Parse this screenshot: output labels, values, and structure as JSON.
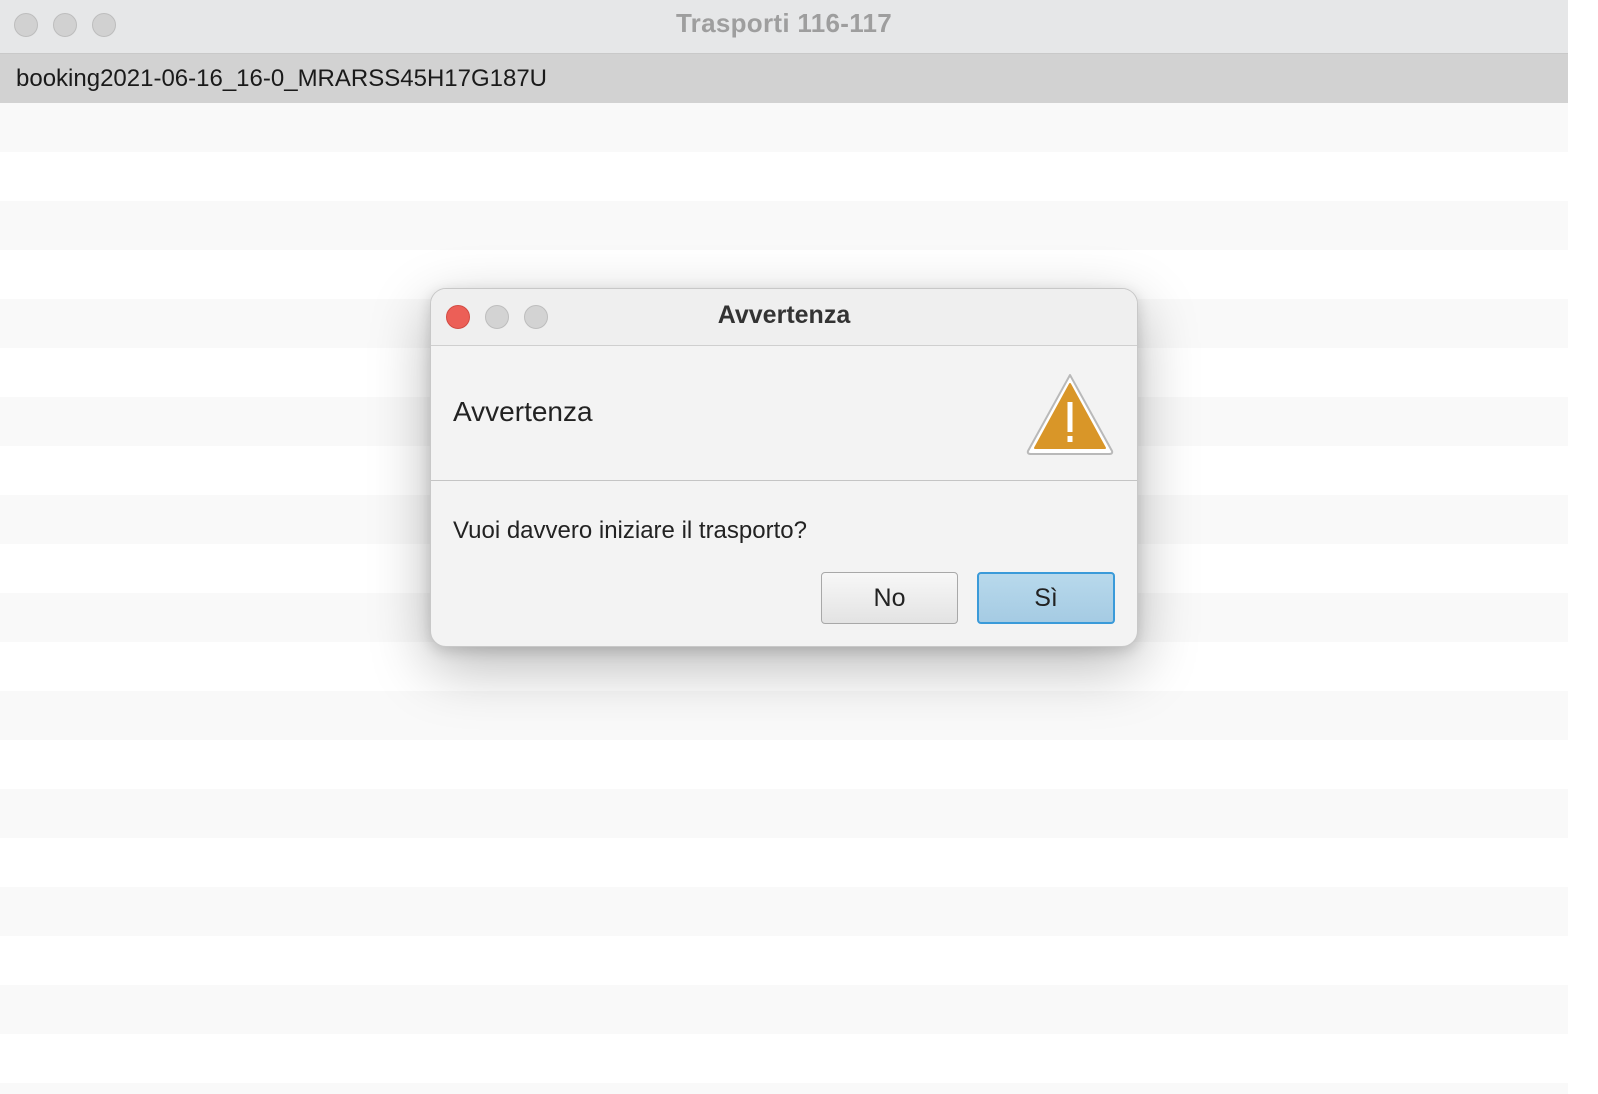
{
  "window": {
    "title": "Trasporti 116-117"
  },
  "list": {
    "items": [
      "booking2021-06-16_16-0_MRARSS45H17G187U"
    ],
    "selected_index": 0
  },
  "dialog": {
    "title": "Avvertenza",
    "header": "Avvertenza",
    "message": "Vuoi davvero iniziare il trasporto?",
    "icon": "warning-icon",
    "buttons": {
      "no": "No",
      "yes": "Sì"
    }
  },
  "colors": {
    "close_button": "#ec5f57",
    "warning_icon": "#d99628",
    "default_button_border": "#3a9ad9",
    "selected_row": "#d2d2d2"
  }
}
